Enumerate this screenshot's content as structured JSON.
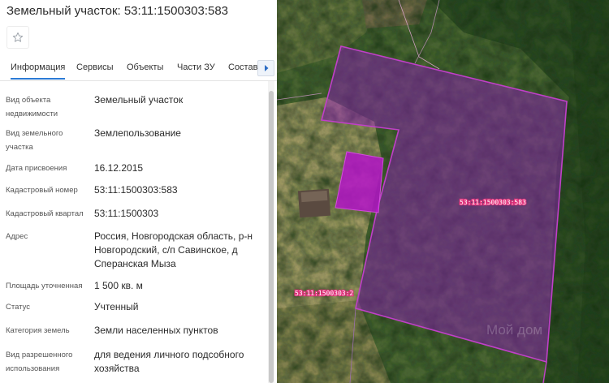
{
  "title": "Земельный участок: 53:11:1500303:583",
  "tabs": [
    {
      "label": "Информация"
    },
    {
      "label": "Сервисы"
    },
    {
      "label": "Объекты"
    },
    {
      "label": "Части ЗУ"
    },
    {
      "label": "Состав"
    }
  ],
  "properties": [
    {
      "label": "Вид объекта недвижимости",
      "value": "Земельный участок"
    },
    {
      "label": "Вид земельного участка",
      "value": "Землепользование"
    },
    {
      "label": "Дата присвоения",
      "value": "16.12.2015"
    },
    {
      "label": "Кадастровый номер",
      "value": "53:11:1500303:583"
    },
    {
      "label": "Кадастровый квартал",
      "value": "53:11:1500303"
    },
    {
      "label": "Адрес",
      "value": "Россия, Новгородская область, р-н Новгородский, с/п Савинское, д Сперанская Мыза"
    },
    {
      "label": "Площадь уточненная",
      "value": "1 500 кв. м"
    },
    {
      "label": "Статус",
      "value": "Учтенный"
    },
    {
      "label": "Категория земель",
      "value": "Земли населенных пунктов"
    },
    {
      "label": "Вид разрешенного использования",
      "value": "для ведения личного подсобного хозяйства"
    }
  ],
  "map": {
    "parcel_label": "53:11:1500303:583",
    "neighbor_label": "53:11:1500303:2",
    "watermark": "Мой дом",
    "colors": {
      "parcel_fill": "#8a20b0",
      "parcel_outline": "#c040c8",
      "building_fill": "#b414c8",
      "label_red": "#e0307a"
    }
  }
}
